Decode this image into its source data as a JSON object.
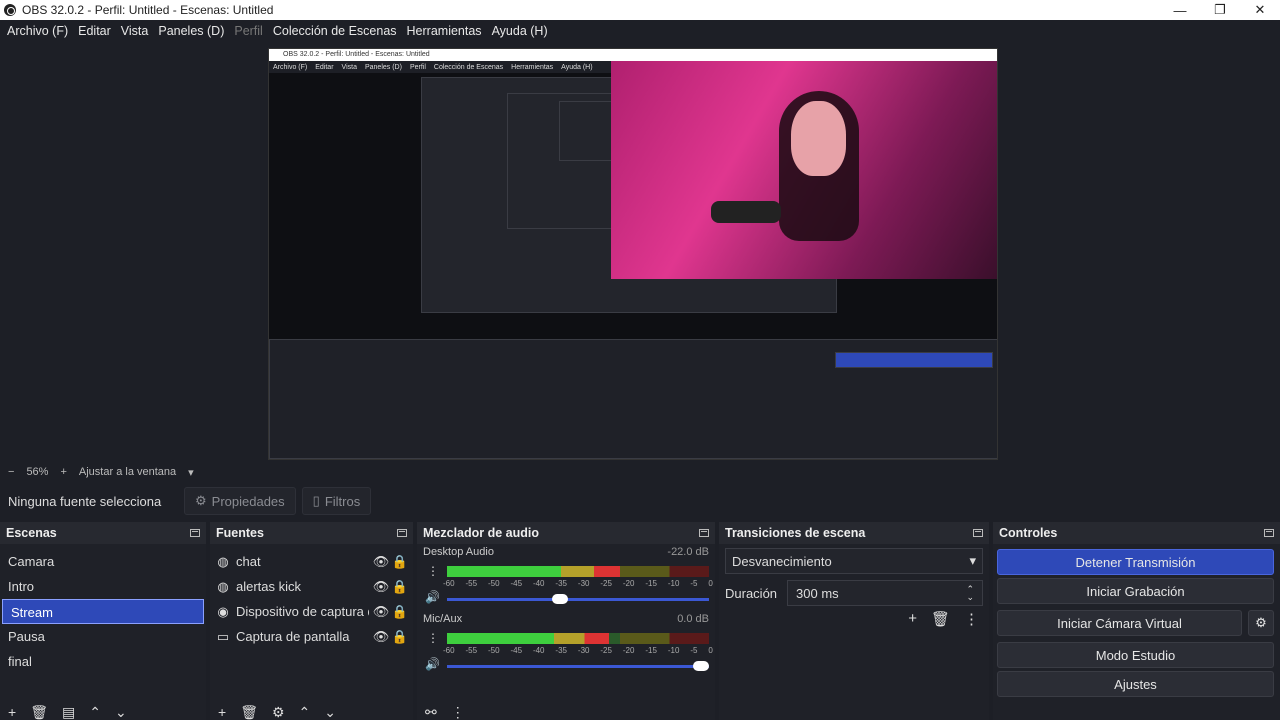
{
  "window": {
    "title": "OBS 32.0.2 - Perfil: Untitled - Escenas: Untitled",
    "minimize": "—",
    "maximize": "❐",
    "close": "✕"
  },
  "menu": [
    {
      "label": "Archivo (F)",
      "enabled": true
    },
    {
      "label": "Editar",
      "enabled": true
    },
    {
      "label": "Vista",
      "enabled": true
    },
    {
      "label": "Paneles (D)",
      "enabled": true
    },
    {
      "label": "Perfil",
      "enabled": false
    },
    {
      "label": "Colección de Escenas",
      "enabled": true
    },
    {
      "label": "Herramientas",
      "enabled": true
    },
    {
      "label": "Ayuda (H)",
      "enabled": true
    }
  ],
  "preview": {
    "inner_title": "OBS 32.0.2 - Perfil: Untitled - Escenas: Untitled",
    "inner_menu": [
      "Archivo (F)",
      "Editar",
      "Vista",
      "Paneles (D)",
      "Perfil",
      "Colección de Escenas",
      "Herramientas",
      "Ayuda (H)"
    ]
  },
  "zoom": {
    "minus": "−",
    "level": "56%",
    "plus": "+",
    "fit_label": "Ajustar a la ventana"
  },
  "source_toolbar": {
    "no_source": "Ninguna fuente selecciona",
    "properties": "Propiedades",
    "filters": "Filtros"
  },
  "scenes": {
    "title": "Escenas",
    "items": [
      "Camara",
      "Intro",
      "Stream",
      "Pausa",
      "final"
    ],
    "selected": "Stream"
  },
  "sources": {
    "title": "Fuentes",
    "items": [
      {
        "name": "chat",
        "icon": "browser-icon"
      },
      {
        "name": "alertas kick",
        "icon": "browser-icon"
      },
      {
        "name": "Dispositivo de captura de",
        "icon": "camera-icon"
      },
      {
        "name": "Captura de pantalla",
        "icon": "monitor-icon"
      }
    ]
  },
  "mixer": {
    "title": "Mezclador de audio",
    "ticks": [
      "-60",
      "-55",
      "-50",
      "-45",
      "-40",
      "-35",
      "-30",
      "-25",
      "-20",
      "-15",
      "-10",
      "-5",
      "0"
    ],
    "channels": [
      {
        "name": "Desktop Audio",
        "db": "-22.0 dB",
        "level": 0.66,
        "volume": 0.46
      },
      {
        "name": "Mic/Aux",
        "db": "0.0 dB",
        "level": 0.62,
        "volume": 1.0
      }
    ]
  },
  "transitions": {
    "title": "Transiciones de escena",
    "selected": "Desvanecimiento",
    "duration_label": "Duración",
    "duration_value": "300 ms"
  },
  "controls": {
    "title": "Controles",
    "stop_stream": "Detener Transmisión",
    "start_recording": "Iniciar Grabación",
    "start_virtual_cam": "Iniciar Cámara Virtual",
    "studio_mode": "Modo Estudio",
    "settings": "Ajustes"
  },
  "colors": {
    "accent": "#2e49b8",
    "background": "#1d1f26",
    "panel": "#272930"
  }
}
